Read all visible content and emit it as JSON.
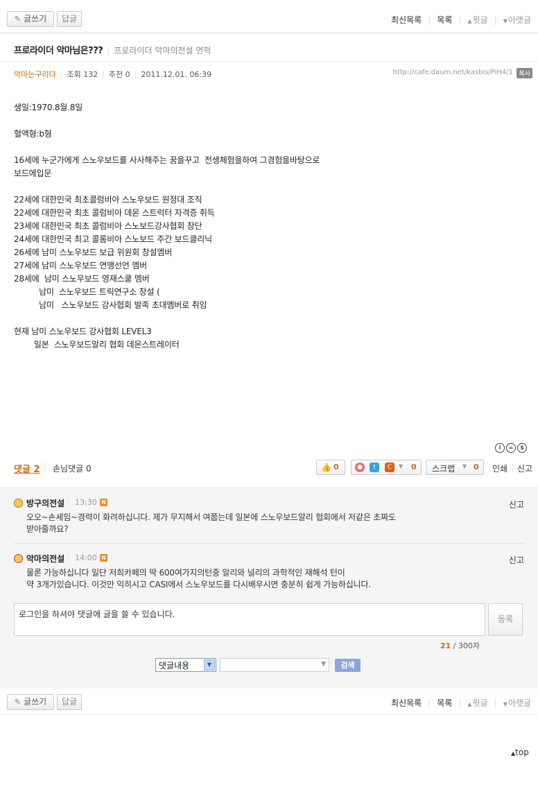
{
  "toolbar": {
    "write_label": "글쓰기",
    "reply_label": "답글",
    "latest_label": "최신목록",
    "list_label": "목록",
    "prev_label": "윗글",
    "next_label": "아랫글"
  },
  "post": {
    "title": "프로라이더 악마님은???",
    "cafe_name": "프로라이더 악마의전설 연혁",
    "author": "악마는구리다",
    "views": "조회 132",
    "recommend": "추천 0",
    "datetime": "2011.12.01. 06:39",
    "url": "http://cafe.daum.net/kasbis/PiH4/1",
    "copy_label": "복사",
    "body_lines": [
      "생일:1970.8월.8일",
      "",
      "혈액형:b형",
      "",
      "16세에 누군가에게 스노우보드를 사사해주는 꿈을꾸고  전생체험을하여 그경험을바탕으로",
      "보드에입문",
      "",
      "22세에 대한민국 최초콜럼비아 스노우보드 원정대 조직",
      "22세에 대한민국 최초 콜럼비아 데몬 스트럭터 자격증 취득",
      "23세에 대한민국 최초 콜럼비아 스노보드강사협회 창단",
      "24세에 대한민국 최고 콜롬비아 스노보드 주간 보드클리닉",
      "26세에 남미 스노우보드 보급 위원회 창설멤버",
      "27세에 남미 스노우보드 연맹선언 멤버",
      "28세에  남미 스노우보드 영재스쿨 멤버",
      "          남미  스노우보드 트릭연구소 창설 (",
      "          남미   스노우보드 강사협회 발족 초대멤버로 취임",
      "",
      "현재 남미 스노우보드 강사협회 LEVEL3",
      "        일본  스노우보드알리 협회 데몬스트레이터"
    ]
  },
  "actions": {
    "comment_label": "댓글",
    "comment_count": "2",
    "guest_comment": "손님댓글 0",
    "like_count": "0",
    "share_count": "0",
    "scrap_label": "스크랩",
    "scrap_count": "0",
    "print_label": "인쇄",
    "report_label": "신고"
  },
  "comments": [
    {
      "nick": "방구의전설",
      "time": "13:30",
      "badge": "N",
      "report": "신고",
      "line1": "오오~손세임~경력이 화려하십니다. 제가 무지해서 여쭙는데 일본에 스노우보드알리 협회에서 저같은 초짜도",
      "line2": "받아줄까요?"
    },
    {
      "nick": "악마의전설",
      "time": "14:00",
      "badge": "N",
      "report": "신고",
      "line1": "물론 가능하십니다 일단 저희카페의 딱 600여가지의턴중 알리와 널리의 과학적인 재해석 턴이",
      "line2": "약 3개가있습니다. 이것만 익히시고 CASI에서 스노우보드를 다시배우시면 충분히 쉽게 가능하십니다."
    }
  ],
  "comment_form": {
    "placeholder": "로그인을 하셔야 댓글에 글을 쓸 수 있습니다.",
    "submit_label": "등록",
    "count_current": "21",
    "count_max": "/ 300자"
  },
  "search": {
    "select_value": "댓글내용",
    "button_label": "검색"
  },
  "top_label": "top"
}
